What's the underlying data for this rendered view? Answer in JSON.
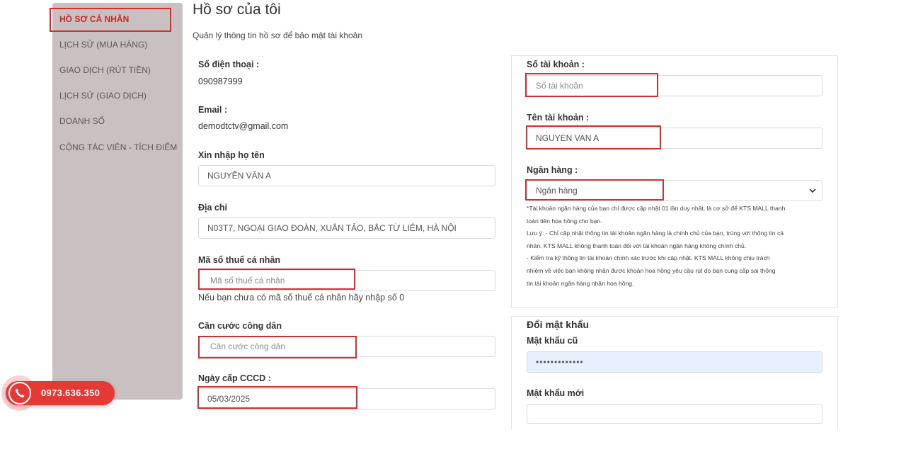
{
  "sidebar": {
    "items": [
      {
        "label": "HỒ SƠ CÁ NHÂN",
        "active": true
      },
      {
        "label": "LỊCH SỬ (MUA HÀNG)"
      },
      {
        "label": "GIAO DỊCH (RÚT TIỀN)"
      },
      {
        "label": "LỊCH SỬ (GIAO DỊCH)"
      },
      {
        "label": "DOANH SỐ"
      },
      {
        "label": "CỘNG TÁC VIÊN - TÍCH ĐIỂM"
      }
    ]
  },
  "header": {
    "title": "Hồ sơ của tôi",
    "subtitle": "Quản lý thông tin hồ sơ để bảo mật tài khoản"
  },
  "profile": {
    "phone_label": "Số điện thoại :",
    "phone_value": "090987999",
    "email_label": "Email :",
    "email_value": "demodtctv@gmail.com",
    "name_label": "Xin nhập họ tên",
    "name_value": "NGUYỄN VĂN A",
    "address_label": "Địa chỉ",
    "address_value": "N03T7, NGOẠI GIAO ĐOÀN, XUÂN TẢO, BẮC TỪ LIÊM, HÀ NỘI",
    "tax_label": "Mã số thuế cá nhân",
    "tax_placeholder": "Mã số thuế cá nhân",
    "tax_hint": "Nếu bạn chưa có mã số thuế cá nhân hãy nhập số 0",
    "cccd_label": "Căn cước công dân",
    "cccd_placeholder": "Căn cước công dân",
    "cccd_date_label": "Ngày cấp CCCD :",
    "cccd_date_value": "05/03/2025"
  },
  "bank": {
    "account_no_label": "Số tài khoản :",
    "account_no_placeholder": "Số tài khoản",
    "account_name_label": "Tên tài khoản :",
    "account_name_value": "NGUYEN VAN A",
    "bank_label": "Ngân hàng :",
    "bank_selected": "Ngân hàng",
    "notes": [
      "*Tài khoản ngân hàng của bạn chỉ được cập nhật 01 lần duy nhất, là cơ sở để KTS MALL thanh",
      "toán tiền hoa hồng cho bạn.",
      "Lưu ý: - Chỉ cập nhật thông tin tài khoản ngân hàng là chính chủ của bạn, trùng với thông tin cá",
      "nhân. KTS MALL không thanh toán đối với tài khoản ngân hàng không chính chủ.",
      "- Kiểm tra kỹ thông tin tài khoản chính xác trước khi cập nhật. KTS MALL không chịu trách",
      "nhiệm về việc bạn không nhận được khoản hoa hồng yêu cầu rút do bạn cung cấp sai thông",
      "tin tài khoản ngân hàng nhận hoa hồng."
    ]
  },
  "password": {
    "title": "Đổi mật khẩu",
    "old_label": "Mật khẩu cũ",
    "old_value": "•••••••••••••",
    "new_label": "Mật khẩu mới"
  },
  "hotline": {
    "number": "0973.636.350"
  },
  "colors": {
    "highlight": "#d32f2f",
    "sidebar_bg": "#c9c1c1",
    "hotline": "#e53935"
  }
}
